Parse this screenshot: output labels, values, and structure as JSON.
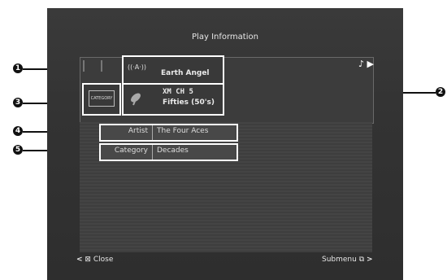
{
  "screen": {
    "title": "Play Information",
    "song": "Earth Angel",
    "channel_line1": "XM  CH  5",
    "channel_line2": "Fifties (50's)",
    "category_icon_text": "CATEGORY",
    "playback_icon": "music-note-play-icon",
    "rows": [
      {
        "label": "Artist",
        "value": "The Four Aces"
      },
      {
        "label": "Category",
        "value": "Decades"
      }
    ],
    "close_label": "Close",
    "submenu_label": "Submenu"
  },
  "callouts": [
    "1",
    "2",
    "3",
    "4",
    "5"
  ]
}
